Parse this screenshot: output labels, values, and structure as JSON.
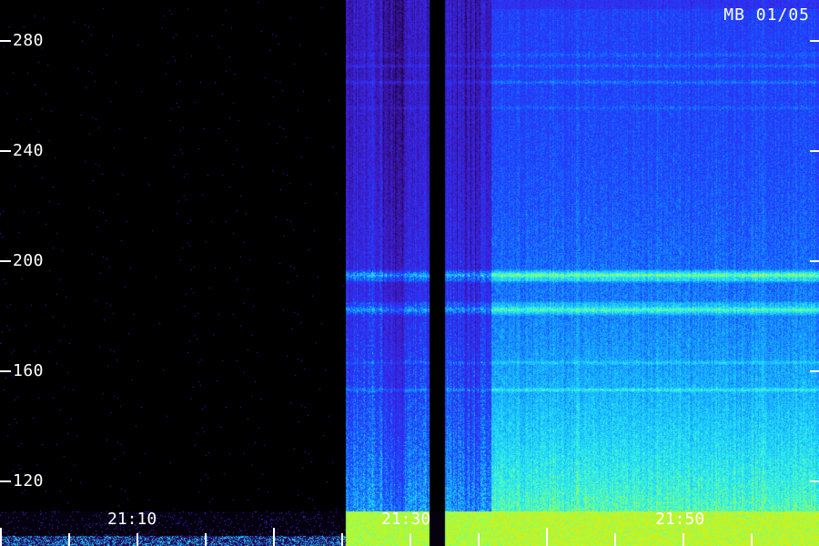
{
  "chart_data": {
    "type": "heatmap",
    "title": "MB 01/05",
    "y_ticks": [
      "280",
      "240",
      "200",
      "160",
      "120"
    ],
    "x_ticks": [
      "21:10",
      "21:30",
      "21:50"
    ],
    "y_range": [
      103,
      288
    ],
    "colormap": [
      "#000000",
      "#2a0a6a",
      "#3a1ad8",
      "#1a40ff",
      "#18b8ff",
      "#40ffd0",
      "#b8ff20",
      "#ffd800"
    ],
    "segments": [
      {
        "start": "21:00",
        "end": "21:24",
        "intensity": 0.02
      },
      {
        "start": "21:24",
        "end": "21:35",
        "intensity": 0.38
      },
      {
        "start": "21:35",
        "end": "21:36",
        "intensity": 0.0
      },
      {
        "start": "21:36",
        "end": "21:35:30",
        "intensity": 0.3
      },
      {
        "start": "21:35:30",
        "end": "22:00",
        "intensity": 0.55
      }
    ],
    "bright_bands_y": [
      194,
      190,
      184,
      170,
      153
    ],
    "legend": "none",
    "grid": false
  }
}
